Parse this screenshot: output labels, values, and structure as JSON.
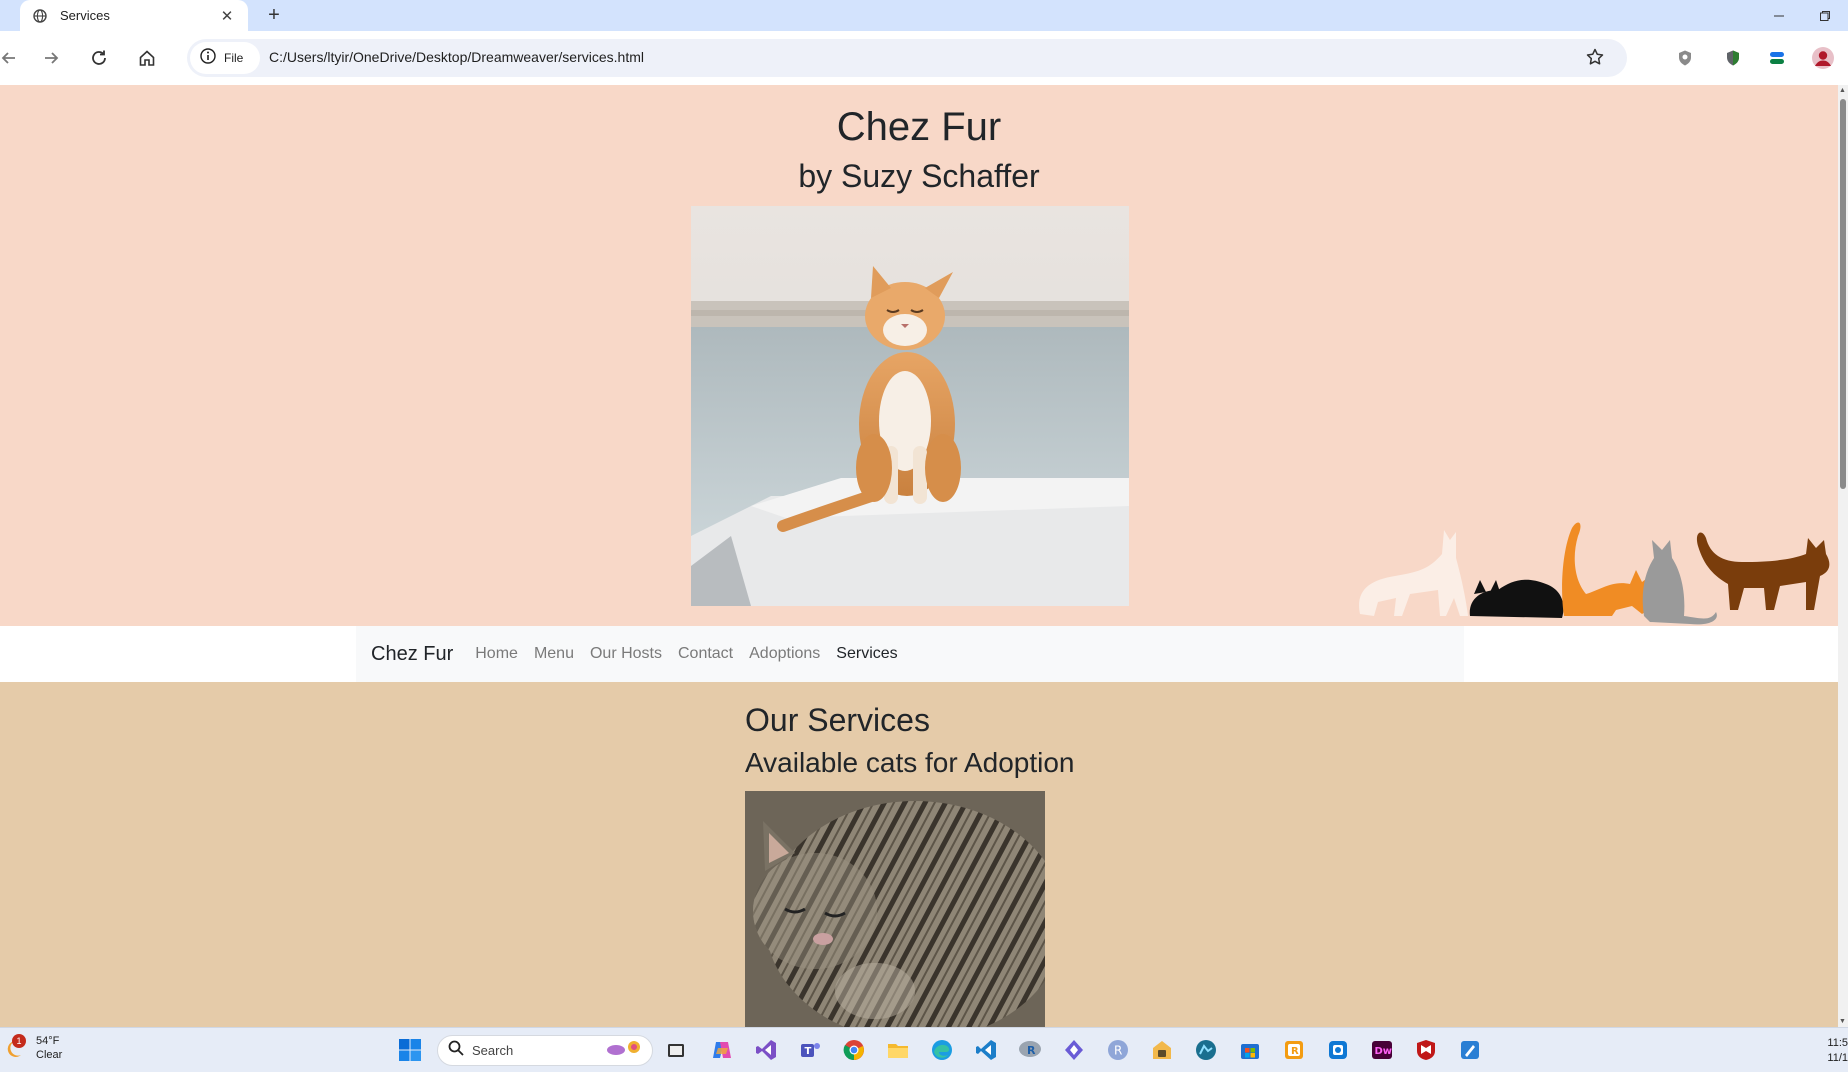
{
  "browser": {
    "tab_title": "Services",
    "site_chip_label": "File",
    "url": "C:/Users/ltyir/OneDrive/Desktop/Dreamweaver/services.html"
  },
  "page": {
    "site_title": "Chez Fur",
    "site_subtitle": "by Suzy Schaffer",
    "nav": {
      "brand": "Chez Fur",
      "links": [
        "Home",
        "Menu",
        "Our Hosts",
        "Contact",
        "Adoptions",
        "Services"
      ],
      "active": "Services"
    },
    "heading": "Our Services",
    "subheading": "Available cats for Adoption"
  },
  "taskbar": {
    "weather_temp": "54°F",
    "weather_cond": "Clear",
    "weather_badge": "1",
    "search_placeholder": "Search",
    "clock_time": "11:5",
    "clock_date": "11/1"
  },
  "colors": {
    "header_bg": "#f8d8c8",
    "content_bg": "#e5cba9",
    "navbar_bg": "#f8f9fa"
  }
}
